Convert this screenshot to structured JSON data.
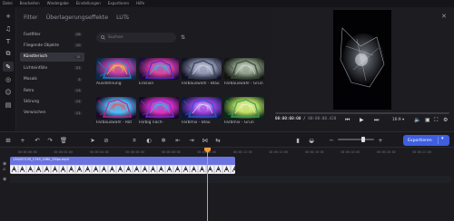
{
  "menu": [
    "Datei",
    "Bearbeiten",
    "Wiedergabe",
    "Einstellungen",
    "Exportieren",
    "Hilfe"
  ],
  "tabs": [
    {
      "label": "Filter",
      "active": true
    },
    {
      "label": "Überlagerungseffekte",
      "active": false
    },
    {
      "label": "LUTs",
      "active": false
    }
  ],
  "categories": [
    {
      "label": "Fastfilter",
      "count": "26"
    },
    {
      "label": "Fliegende Objekte",
      "count": "10"
    },
    {
      "label": "Künstlerisch",
      "count": "28"
    },
    {
      "label": "Lichteinfälle",
      "count": "21"
    },
    {
      "label": "Mosaik",
      "count": "3"
    },
    {
      "label": "Retro",
      "count": "13"
    },
    {
      "label": "Störung",
      "count": "11"
    },
    {
      "label": "Verwischen",
      "count": "11"
    }
  ],
  "active_category_index": 2,
  "search": {
    "placeholder": "Suchen"
  },
  "effects": [
    {
      "line1": "Ausdehnung",
      "line2": "",
      "style": "expand"
    },
    {
      "line1": "Erosion",
      "line2": "",
      "style": "erosion"
    },
    {
      "line1": "Farbauswahl -",
      "line2": "Blau",
      "style": "blue"
    },
    {
      "line1": "Farbauswahl -",
      "line2": "Grün",
      "style": "green"
    },
    {
      "line1": "Farbauswahl - Rot",
      "line2": "",
      "style": "red"
    },
    {
      "line1": "Farbig nach-",
      "line2": "",
      "style": "colorful"
    },
    {
      "line1": "Farbmix - Blau",
      "line2": "",
      "style": "mixblue"
    },
    {
      "line1": "Farbmix - Grün",
      "line2": "",
      "style": "mixgreen"
    }
  ],
  "preview": {
    "time_current": "00:00:00",
    "time_current_frames": ":00",
    "time_separator": " / ",
    "time_total": "00:00:00.420",
    "aspect_ratio": "16:9"
  },
  "export": {
    "label": "Exportieren"
  },
  "ruler_ticks": [
    "00:00:00:00",
    "00:00:02:00",
    "00:00:04:00",
    "00:00:06:00",
    "00:00:08:00",
    "00:00:10:00",
    "00:00:12:00",
    "00:00:14:00",
    "00:00:16:00",
    "00:00:18:00",
    "00:00:20:00",
    "00:00:22:00"
  ],
  "clip": {
    "name": "130437135_1749_1080_25fps.mp4"
  },
  "colors": {
    "accent": "#3f5fe0",
    "playhead": "#f29a38",
    "clip": "#6a73e0",
    "background": "#1b1b20"
  }
}
